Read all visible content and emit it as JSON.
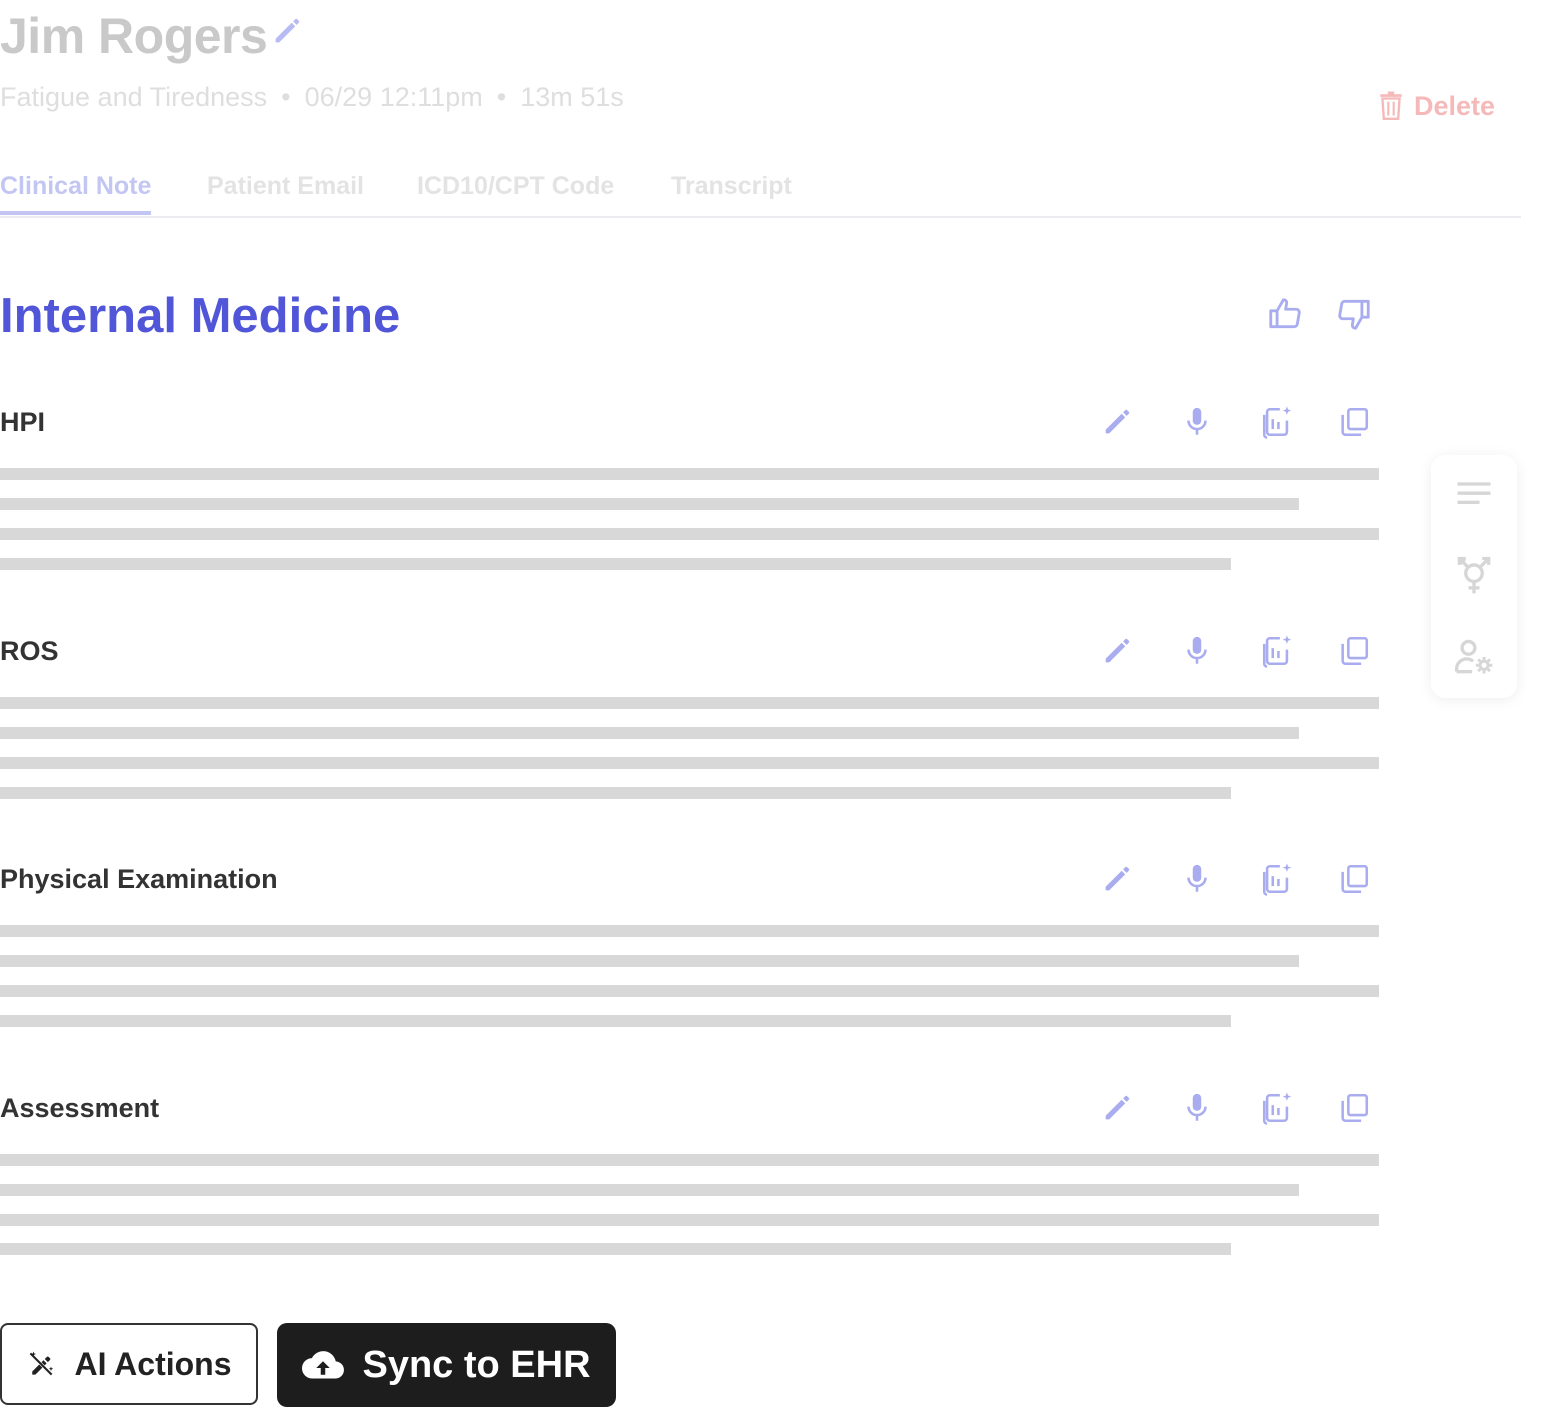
{
  "header": {
    "patient_name": "Jim Rogers",
    "visit_reason": "Fatigue and Tiredness",
    "date_time": "06/29 12:11pm",
    "duration": "13m 51s",
    "separator": "•",
    "delete_label": "Delete"
  },
  "tabs": [
    {
      "label": "Clinical Note",
      "active": true
    },
    {
      "label": "Patient Email",
      "active": false
    },
    {
      "label": "ICD10/CPT Code",
      "active": false
    },
    {
      "label": "Transcript",
      "active": false
    }
  ],
  "note": {
    "title": "Internal Medicine",
    "sections": [
      {
        "title": "HPI"
      },
      {
        "title": "ROS"
      },
      {
        "title": "Physical Examination"
      },
      {
        "title": "Assessment"
      }
    ]
  },
  "section_actions": [
    "edit-icon",
    "microphone-icon",
    "ai-enhance-icon",
    "copy-icon"
  ],
  "side_toolbar": [
    "text-align-icon",
    "gender-icon",
    "user-settings-icon"
  ],
  "footer": {
    "ai_actions_label": "AI Actions",
    "sync_label": "Sync to EHR"
  },
  "colors": {
    "accent": "#5156d8",
    "icon_accent": "#a9adf0",
    "delete": "#f6b9b9",
    "sync_button": "#1d1d1d"
  }
}
